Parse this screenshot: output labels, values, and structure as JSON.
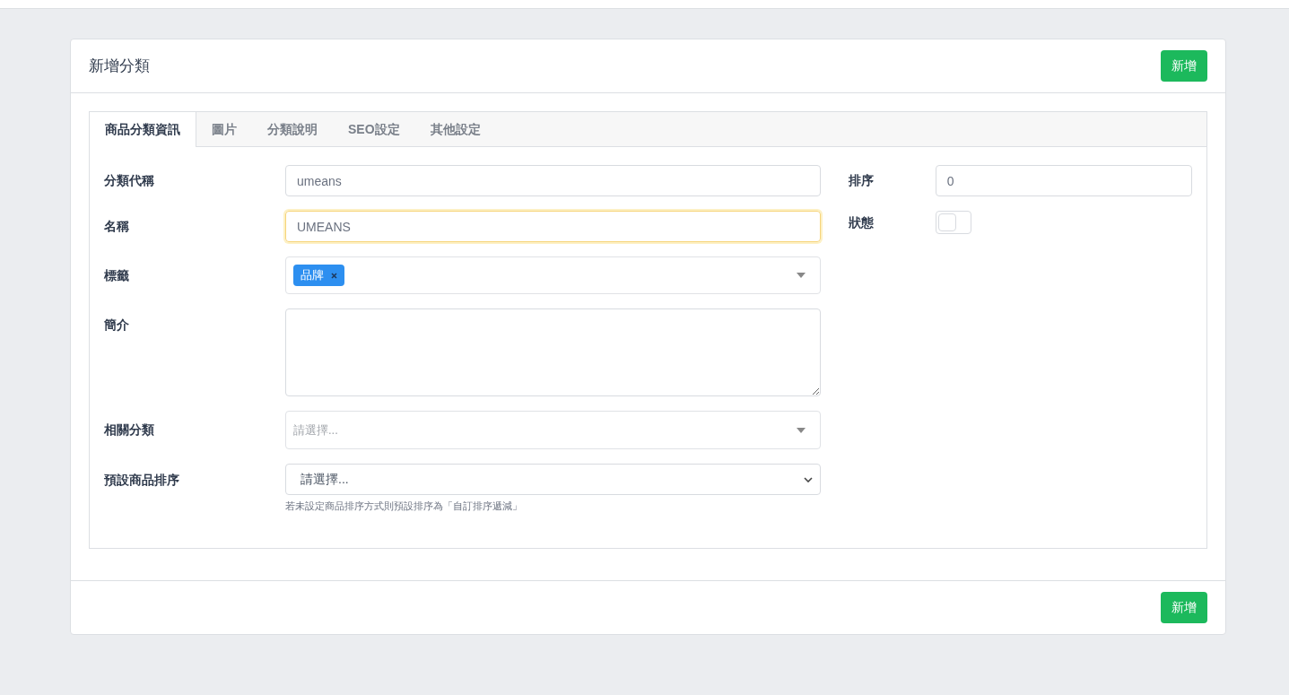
{
  "header": {
    "title": "新增分類",
    "button": "新增"
  },
  "tabs": [
    {
      "label": "商品分類資訊",
      "selected": true
    },
    {
      "label": "圖片",
      "selected": false
    },
    {
      "label": "分類說明",
      "selected": false
    },
    {
      "label": "SEO設定",
      "selected": false
    },
    {
      "label": "其他設定",
      "selected": false
    }
  ],
  "left_fields": [
    {
      "kind": "text",
      "label": "分類代稱",
      "value": "umeans",
      "focused": false
    },
    {
      "kind": "text",
      "label": "名稱",
      "value": "UMEANS",
      "focused": true
    },
    {
      "kind": "tags",
      "label": "標籤",
      "tags": [
        "品牌"
      ]
    },
    {
      "kind": "textarea",
      "label": "簡介"
    },
    {
      "kind": "multiselect",
      "label": "相關分類",
      "placeholder": "請選擇..."
    },
    {
      "kind": "select",
      "label": "預設商品排序",
      "value": "請選擇...",
      "help": "若未設定商品排序方式則預設排序為「自訂排序遞減」"
    }
  ],
  "right_fields": [
    {
      "kind": "text",
      "label": "排序",
      "value": "0",
      "focused": false
    },
    {
      "kind": "switch",
      "label": "狀態",
      "on": false
    }
  ],
  "footer": {
    "button": "新增"
  }
}
